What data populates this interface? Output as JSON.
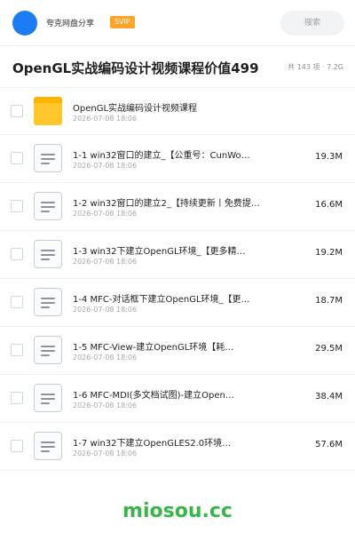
{
  "header": {
    "user_name": "夸克网盘分享",
    "badge": "SVIP",
    "search_label": "搜索"
  },
  "title_bar": {
    "title": "OpenGL实战编码设计视频课程价值499",
    "summary": "共 143 项 · 7.2G"
  },
  "files": [
    {
      "type": "folder-icon",
      "name": "OpenGL实战编码设计视频课程",
      "date": "2026-07-08 18:06",
      "size": ""
    },
    {
      "type": "document-icon",
      "name": "1-1 win32窗口的建立_【公重号：CunWo…",
      "date": "2026-07-08 18:06",
      "size": "19.3M"
    },
    {
      "type": "document-icon",
      "name": "1-2 win32窗口的建立2_【持续更新丨免费提…",
      "date": "2026-07-08 18:06",
      "size": "16.6M"
    },
    {
      "type": "document-icon",
      "name": "1-3 win32下建立OpenGL环境_【更多精…",
      "date": "2026-07-08 18:06",
      "size": "19.2M"
    },
    {
      "type": "document-icon",
      "name": "1-4 MFC-对话框下建立OpenGL环境_【更…",
      "date": "2026-07-08 18:06",
      "size": "18.7M"
    },
    {
      "type": "document-icon",
      "name": "1-5 MFC-View-建立OpenGL环境【耗…",
      "date": "2026-07-08 18:06",
      "size": "29.5M"
    },
    {
      "type": "document-icon",
      "name": "1-6 MFC-MDI(多文档试图)-建立Open…",
      "date": "2026-07-08 18:06",
      "size": "38.4M"
    },
    {
      "type": "document-icon",
      "name": "1-7 win32下建立OpenGLES2.0环境…",
      "date": "2026-07-08 18:06",
      "size": "57.6M"
    }
  ],
  "watermark": "miosou.cc",
  "colors": {
    "avatar": "#1e7cf2",
    "badge": "#ffa32b",
    "folder": "#ffc72c",
    "watermark": "#3ab54a"
  }
}
